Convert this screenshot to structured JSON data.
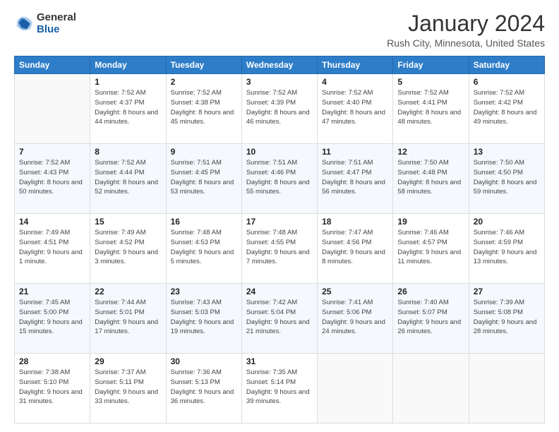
{
  "header": {
    "logo_line1": "General",
    "logo_line2": "Blue",
    "month_year": "January 2024",
    "location": "Rush City, Minnesota, United States"
  },
  "days_of_week": [
    "Sunday",
    "Monday",
    "Tuesday",
    "Wednesday",
    "Thursday",
    "Friday",
    "Saturday"
  ],
  "weeks": [
    [
      {
        "num": "",
        "sunrise": "",
        "sunset": "",
        "daylight": ""
      },
      {
        "num": "1",
        "sunrise": "Sunrise: 7:52 AM",
        "sunset": "Sunset: 4:37 PM",
        "daylight": "Daylight: 8 hours and 44 minutes."
      },
      {
        "num": "2",
        "sunrise": "Sunrise: 7:52 AM",
        "sunset": "Sunset: 4:38 PM",
        "daylight": "Daylight: 8 hours and 45 minutes."
      },
      {
        "num": "3",
        "sunrise": "Sunrise: 7:52 AM",
        "sunset": "Sunset: 4:39 PM",
        "daylight": "Daylight: 8 hours and 46 minutes."
      },
      {
        "num": "4",
        "sunrise": "Sunrise: 7:52 AM",
        "sunset": "Sunset: 4:40 PM",
        "daylight": "Daylight: 8 hours and 47 minutes."
      },
      {
        "num": "5",
        "sunrise": "Sunrise: 7:52 AM",
        "sunset": "Sunset: 4:41 PM",
        "daylight": "Daylight: 8 hours and 48 minutes."
      },
      {
        "num": "6",
        "sunrise": "Sunrise: 7:52 AM",
        "sunset": "Sunset: 4:42 PM",
        "daylight": "Daylight: 8 hours and 49 minutes."
      }
    ],
    [
      {
        "num": "7",
        "sunrise": "Sunrise: 7:52 AM",
        "sunset": "Sunset: 4:43 PM",
        "daylight": "Daylight: 8 hours and 50 minutes."
      },
      {
        "num": "8",
        "sunrise": "Sunrise: 7:52 AM",
        "sunset": "Sunset: 4:44 PM",
        "daylight": "Daylight: 8 hours and 52 minutes."
      },
      {
        "num": "9",
        "sunrise": "Sunrise: 7:51 AM",
        "sunset": "Sunset: 4:45 PM",
        "daylight": "Daylight: 8 hours and 53 minutes."
      },
      {
        "num": "10",
        "sunrise": "Sunrise: 7:51 AM",
        "sunset": "Sunset: 4:46 PM",
        "daylight": "Daylight: 8 hours and 55 minutes."
      },
      {
        "num": "11",
        "sunrise": "Sunrise: 7:51 AM",
        "sunset": "Sunset: 4:47 PM",
        "daylight": "Daylight: 8 hours and 56 minutes."
      },
      {
        "num": "12",
        "sunrise": "Sunrise: 7:50 AM",
        "sunset": "Sunset: 4:48 PM",
        "daylight": "Daylight: 8 hours and 58 minutes."
      },
      {
        "num": "13",
        "sunrise": "Sunrise: 7:50 AM",
        "sunset": "Sunset: 4:50 PM",
        "daylight": "Daylight: 8 hours and 59 minutes."
      }
    ],
    [
      {
        "num": "14",
        "sunrise": "Sunrise: 7:49 AM",
        "sunset": "Sunset: 4:51 PM",
        "daylight": "Daylight: 9 hours and 1 minute."
      },
      {
        "num": "15",
        "sunrise": "Sunrise: 7:49 AM",
        "sunset": "Sunset: 4:52 PM",
        "daylight": "Daylight: 9 hours and 3 minutes."
      },
      {
        "num": "16",
        "sunrise": "Sunrise: 7:48 AM",
        "sunset": "Sunset: 4:53 PM",
        "daylight": "Daylight: 9 hours and 5 minutes."
      },
      {
        "num": "17",
        "sunrise": "Sunrise: 7:48 AM",
        "sunset": "Sunset: 4:55 PM",
        "daylight": "Daylight: 9 hours and 7 minutes."
      },
      {
        "num": "18",
        "sunrise": "Sunrise: 7:47 AM",
        "sunset": "Sunset: 4:56 PM",
        "daylight": "Daylight: 9 hours and 8 minutes."
      },
      {
        "num": "19",
        "sunrise": "Sunrise: 7:46 AM",
        "sunset": "Sunset: 4:57 PM",
        "daylight": "Daylight: 9 hours and 11 minutes."
      },
      {
        "num": "20",
        "sunrise": "Sunrise: 7:46 AM",
        "sunset": "Sunset: 4:59 PM",
        "daylight": "Daylight: 9 hours and 13 minutes."
      }
    ],
    [
      {
        "num": "21",
        "sunrise": "Sunrise: 7:45 AM",
        "sunset": "Sunset: 5:00 PM",
        "daylight": "Daylight: 9 hours and 15 minutes."
      },
      {
        "num": "22",
        "sunrise": "Sunrise: 7:44 AM",
        "sunset": "Sunset: 5:01 PM",
        "daylight": "Daylight: 9 hours and 17 minutes."
      },
      {
        "num": "23",
        "sunrise": "Sunrise: 7:43 AM",
        "sunset": "Sunset: 5:03 PM",
        "daylight": "Daylight: 9 hours and 19 minutes."
      },
      {
        "num": "24",
        "sunrise": "Sunrise: 7:42 AM",
        "sunset": "Sunset: 5:04 PM",
        "daylight": "Daylight: 9 hours and 21 minutes."
      },
      {
        "num": "25",
        "sunrise": "Sunrise: 7:41 AM",
        "sunset": "Sunset: 5:06 PM",
        "daylight": "Daylight: 9 hours and 24 minutes."
      },
      {
        "num": "26",
        "sunrise": "Sunrise: 7:40 AM",
        "sunset": "Sunset: 5:07 PM",
        "daylight": "Daylight: 9 hours and 26 minutes."
      },
      {
        "num": "27",
        "sunrise": "Sunrise: 7:39 AM",
        "sunset": "Sunset: 5:08 PM",
        "daylight": "Daylight: 9 hours and 28 minutes."
      }
    ],
    [
      {
        "num": "28",
        "sunrise": "Sunrise: 7:38 AM",
        "sunset": "Sunset: 5:10 PM",
        "daylight": "Daylight: 9 hours and 31 minutes."
      },
      {
        "num": "29",
        "sunrise": "Sunrise: 7:37 AM",
        "sunset": "Sunset: 5:11 PM",
        "daylight": "Daylight: 9 hours and 33 minutes."
      },
      {
        "num": "30",
        "sunrise": "Sunrise: 7:36 AM",
        "sunset": "Sunset: 5:13 PM",
        "daylight": "Daylight: 9 hours and 36 minutes."
      },
      {
        "num": "31",
        "sunrise": "Sunrise: 7:35 AM",
        "sunset": "Sunset: 5:14 PM",
        "daylight": "Daylight: 9 hours and 39 minutes."
      },
      {
        "num": "",
        "sunrise": "",
        "sunset": "",
        "daylight": ""
      },
      {
        "num": "",
        "sunrise": "",
        "sunset": "",
        "daylight": ""
      },
      {
        "num": "",
        "sunrise": "",
        "sunset": "",
        "daylight": ""
      }
    ]
  ]
}
